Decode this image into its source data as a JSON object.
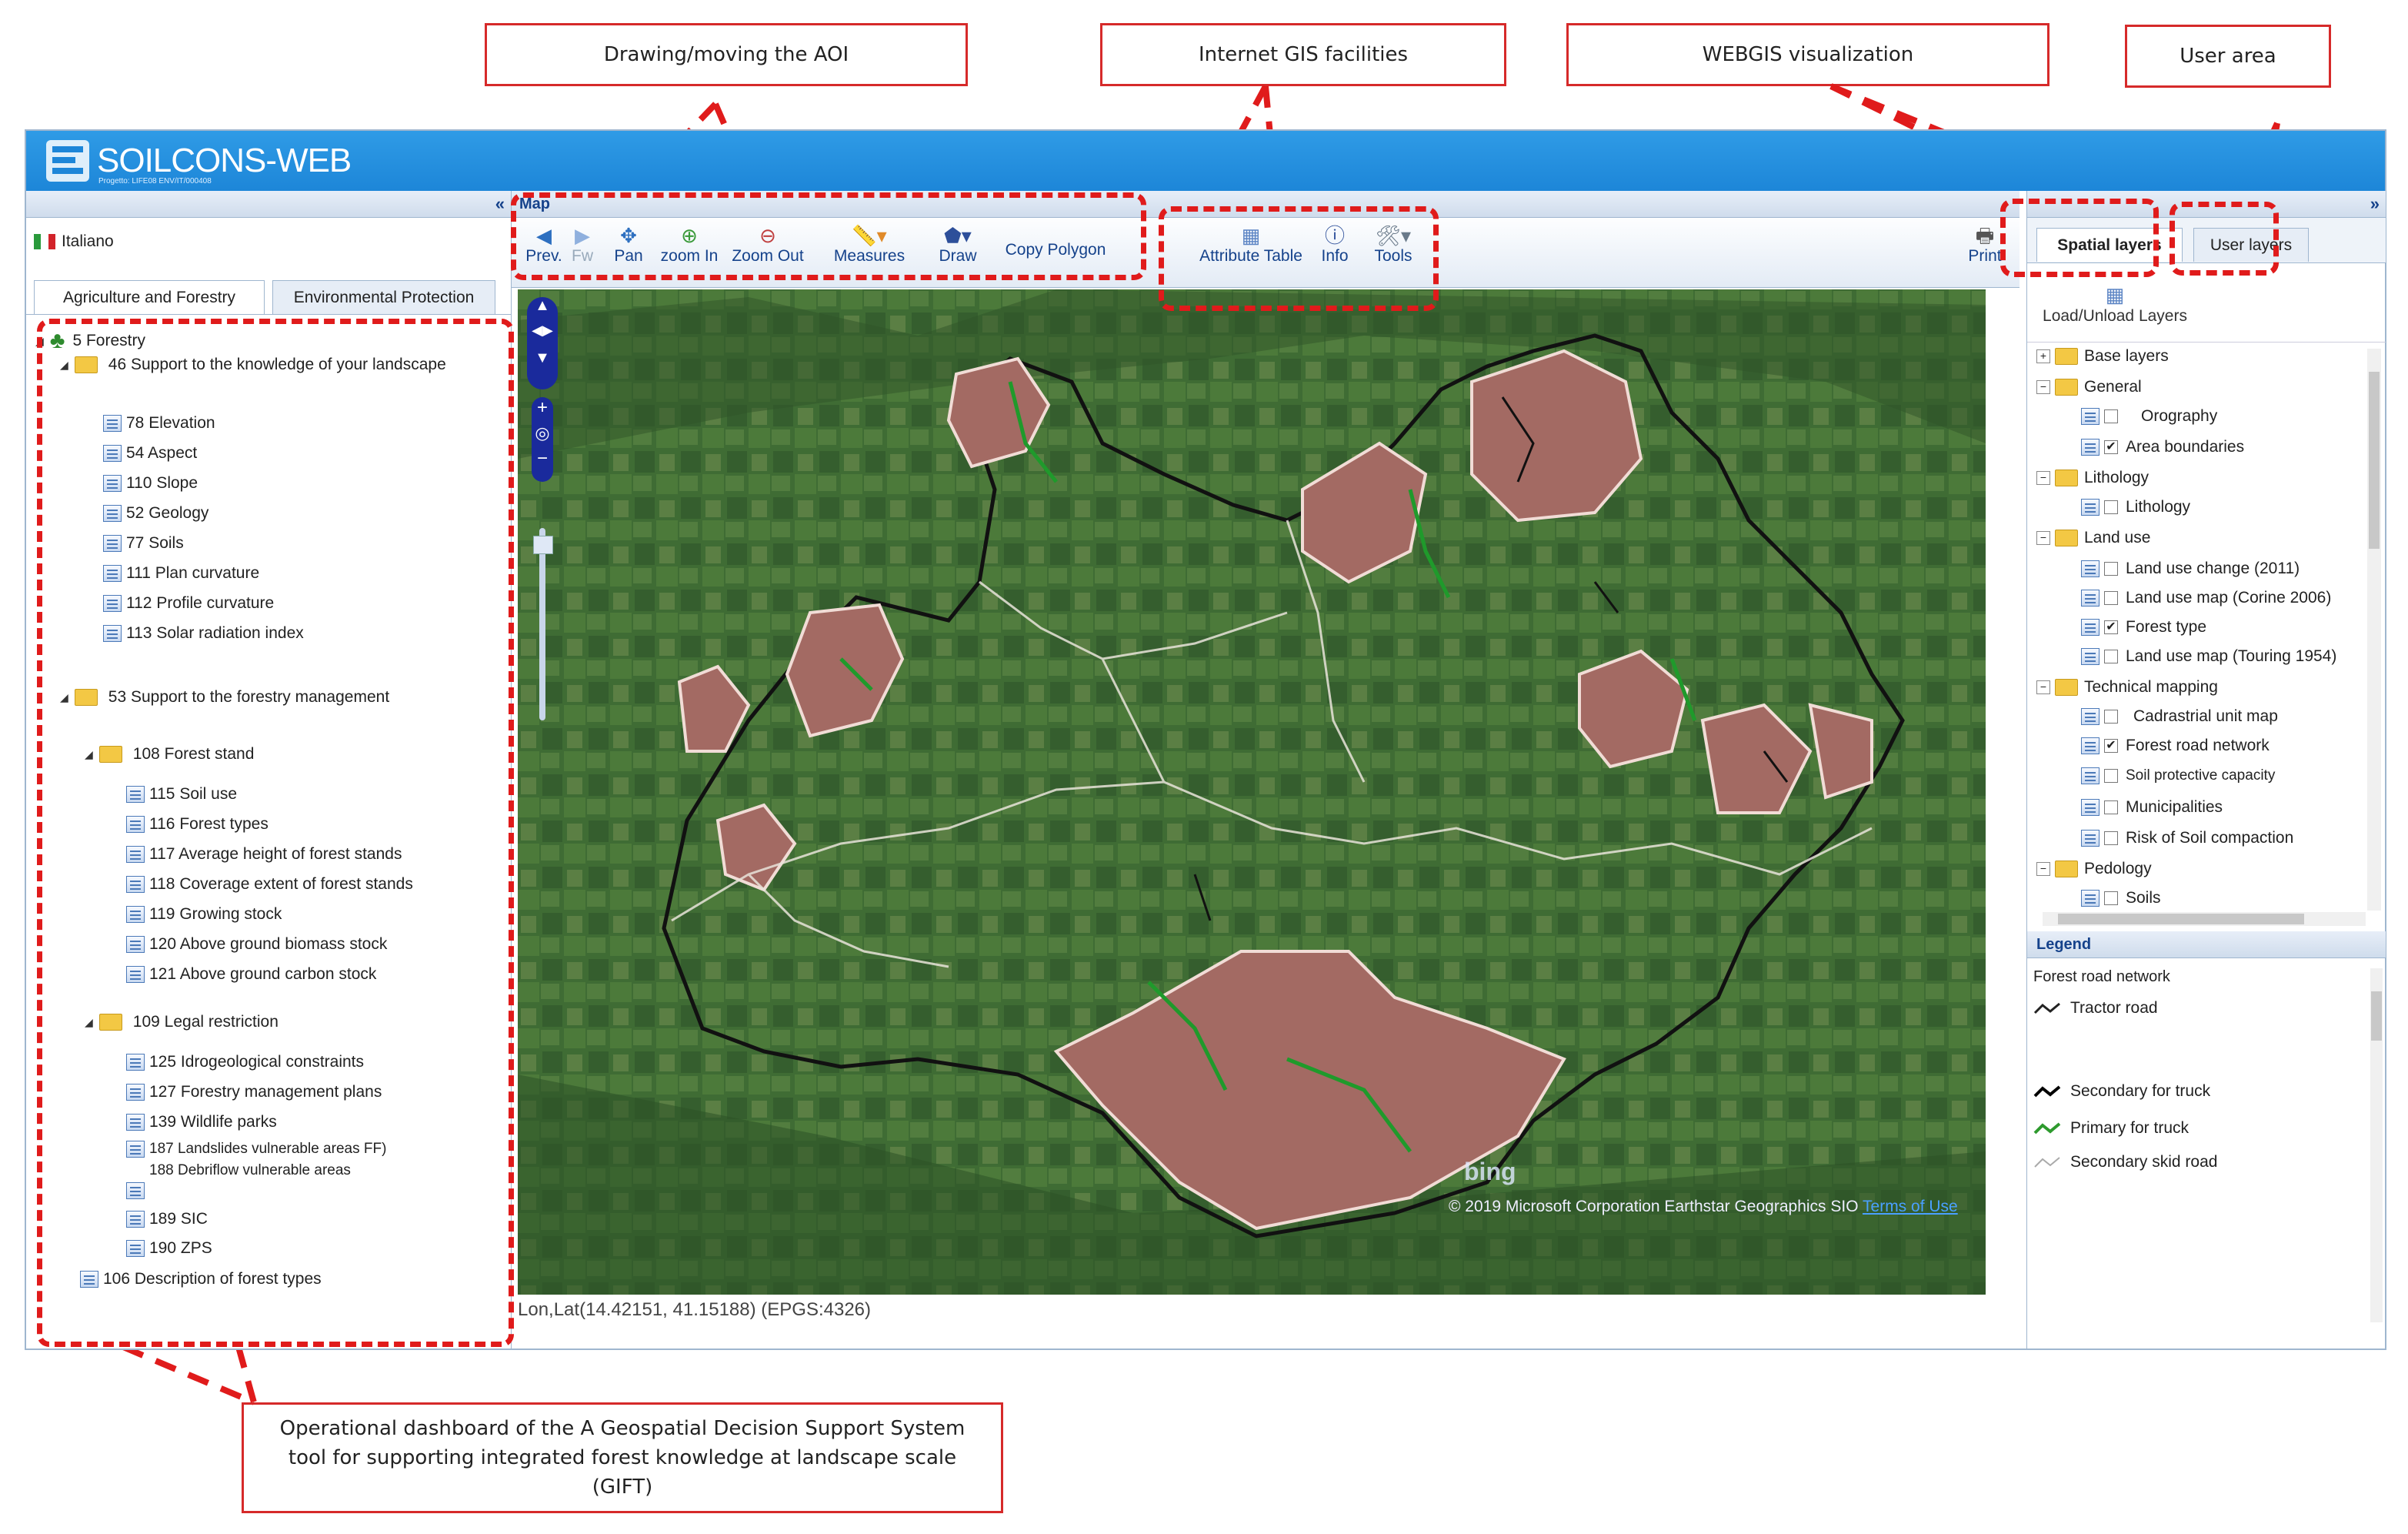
{
  "callouts": {
    "aoi": "Drawing/moving the AOI",
    "gis": "Internet GIS facilities",
    "webgis": "WEBGIS visualization",
    "user": "User area",
    "dashboard": "Operational dashboard of the A Geospatial Decision Support System tool for supporting integrated forest knowledge at landscape scale (GIFT)"
  },
  "app": {
    "title": "SOILCONS-WEB",
    "subtitle": "Progetto: LIFE08 ENV/IT/000408",
    "language": "Italiano",
    "tabs": [
      "Agriculture and Forestry",
      "Environmental Protection"
    ],
    "map_title": "Map",
    "coords": "Lon,Lat(14.42151, 41.15188) (EPGS:4326)",
    "attribution": "© 2019 Microsoft Corporation Earthstar Geographics SIO",
    "terms": "Terms of Use",
    "bing": "bing"
  },
  "toolbar": {
    "prev": "Prev.",
    "next": "Fw",
    "pan": "Pan",
    "zoom_in": "zoom In",
    "zoom_out": "Zoom Out",
    "measures": "Measures",
    "draw": "Draw",
    "copy_polygon": "Copy Polygon",
    "attribute_table": "Attribute Table",
    "info": "Info",
    "tools": "Tools",
    "print": "Print"
  },
  "tree": {
    "root": "5 Forestry",
    "g46": "46 Support to the knowledge of your landscape",
    "g46_items": [
      "78 Elevation",
      "54 Aspect",
      "110 Slope",
      "52 Geology",
      "77 Soils",
      "111 Plan curvature",
      "112 Profile curvature",
      "113 Solar radiation index"
    ],
    "g53": "53 Support to the forestry management",
    "g108": "108 Forest stand",
    "g108_items": [
      "115 Soil use",
      "116 Forest types",
      "117 Average height of forest stands",
      "118 Coverage extent of forest stands",
      "119 Growing stock",
      "120 Above ground biomass stock",
      "121 Above ground carbon stock"
    ],
    "g109": "109 Legal restriction",
    "g109_items": [
      "125 Idrogeological constraints",
      "127 Forestry management plans",
      "139 Wildlife parks"
    ],
    "landslides": "187 Landslides vulnerable areas FF)",
    "debrisflow": "188 Debriflow vulnerable areas",
    "sic": "189 SIC",
    "zps": "190 ZPS",
    "g106": "106 Description of forest types"
  },
  "right": {
    "tab_spatial": "Spatial layers",
    "tab_user": "User layers",
    "load_unload": "Load/Unload Layers",
    "base_layers": "Base layers",
    "general": "General",
    "orography": "Orography",
    "area_boundaries": "Area boundaries",
    "lithology_group": "Lithology",
    "lithology": "Lithology",
    "land_use": "Land use",
    "luc": "Land use change (2011)",
    "lum_corine": "Land use map (Corine 2006)",
    "forest_type": "Forest type",
    "lum_touring": "Land use map (Touring 1954)",
    "technical": "Technical mapping",
    "cadastral": "Cadrastrial unit map",
    "forest_road": "Forest road network",
    "soil_protective": "Soil protective capacity",
    "municipalities": "Municipalities",
    "risk_soil": "Risk of Soil compaction",
    "pedology": "Pedology",
    "soils": "Soils",
    "legend_title": "Legend",
    "legend_layer": "Forest road network",
    "legend_items": [
      "Tractor road",
      "Secondary for truck",
      "Primary for truck",
      "Secondary skid road"
    ],
    "legend_colors": [
      "#222222",
      "#000000",
      "#2e9a2e",
      "#aaaaaa"
    ]
  }
}
